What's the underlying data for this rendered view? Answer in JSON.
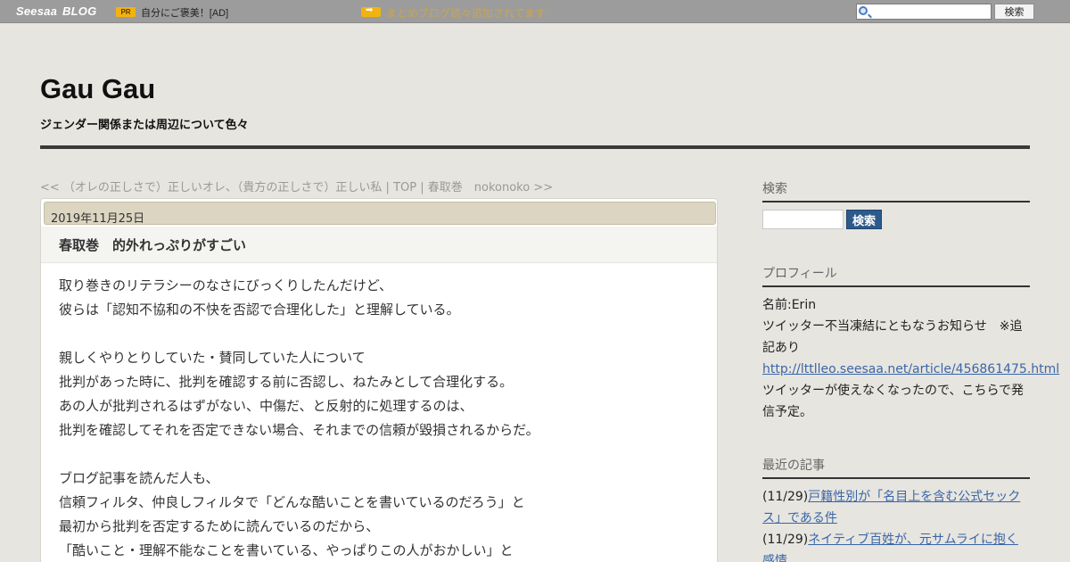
{
  "topbar": {
    "logo_main": "Seesaa",
    "logo_sub": "BLOG",
    "pr_badge": "PR",
    "ad_text": "自分にご褒美！[AD]",
    "news_icon": "arrow-right-icon",
    "news_text": "まとめブログ続々追加されてます",
    "search_placeholder": "",
    "search_button": "検索"
  },
  "header": {
    "title": "Gau Gau",
    "description": "ジェンダー関係または周辺について色々"
  },
  "nav": {
    "prev": "<< （オレの正しさで）正しいオレ、（貴方の正しさで）正しい私",
    "sep1": " | ",
    "top": "TOP",
    "sep2": " | ",
    "next": "春取巻　nokonoko >>"
  },
  "article": {
    "date": "2019年11月25日",
    "title": "春取巻　的外れっぷりがすごい",
    "lines": [
      "取り巻きのリテラシーのなさにびっくりしたんだけど、",
      "彼らは「認知不協和の不快を否認で合理化した」と理解している。",
      "",
      "親しくやりとりしていた・賛同していた人について",
      "批判があった時に、批判を確認する前に否認し、ねたみとして合理化する。",
      "あの人が批判されるはずがない、中傷だ、と反射的に処理するのは、",
      "批判を確認してそれを否定できない場合、それまでの信頼が毀損されるからだ。",
      "",
      "ブログ記事を読んだ人も、",
      "信頼フィルタ、仲良しフィルタで「どんな酷いことを書いているのだろう」と",
      "最初から批判を否定するために読んでいるのだから、",
      "「酷いこと・理解不能なことを書いている、やっぱりこの人がおかしい」と"
    ]
  },
  "sidebar": {
    "search_heading": "検索",
    "search_button": "検索",
    "profile_heading": "プロフィール",
    "profile_name": "名前:Erin",
    "profile_line1": "ツイッター不当凍結にともなうお知らせ　※追記あり",
    "profile_link": "http://lttlleo.seesaa.net/article/456861475.html",
    "profile_line2": "ツイッターが使えなくなったので、こちらで発信予定。",
    "recent_heading": "最近の記事",
    "recent": [
      {
        "date": "(11/29)",
        "title": "戸籍性別が「名目上を含む公式セックス」である件"
      },
      {
        "date": "(11/29)",
        "title": "ネイティブ百姓が、元サムライに抱く感情"
      }
    ]
  }
}
